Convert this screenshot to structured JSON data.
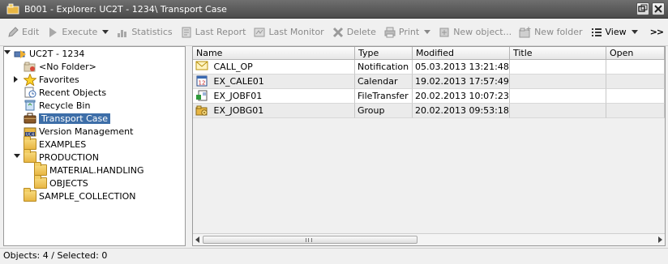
{
  "window": {
    "title": "B001 - Explorer: UC2T - 1234\\ Transport Case",
    "icon": "explorer-window-icon"
  },
  "toolbar": {
    "edit": "Edit",
    "execute": "Execute",
    "statistics": "Statistics",
    "last_report": "Last Report",
    "last_monitor": "Last Monitor",
    "delete": "Delete",
    "print": "Print",
    "new_object": "New object...",
    "new_folder": "New folder",
    "view": "View",
    "more": ">>"
  },
  "tree": {
    "root": "UC2T - 1234",
    "items": [
      {
        "label": "<No Folder>",
        "icon": "no-folder-icon"
      },
      {
        "label": "Favorites",
        "icon": "star-icon"
      },
      {
        "label": "Recent Objects",
        "icon": "recent-objects-icon"
      },
      {
        "label": "Recycle Bin",
        "icon": "recycle-bin-icon"
      },
      {
        "label": "Transport Case",
        "icon": "transport-case-icon",
        "selected": true
      },
      {
        "label": "Version Management",
        "icon": "version-management-icon"
      },
      {
        "label": "EXAMPLES",
        "icon": "folder-icon"
      },
      {
        "label": "PRODUCTION",
        "icon": "folder-icon"
      },
      {
        "label": "MATERIAL.HANDLING",
        "icon": "folder-icon"
      },
      {
        "label": "OBJECTS",
        "icon": "folder-icon"
      },
      {
        "label": "SAMPLE_COLLECTION",
        "icon": "folder-icon"
      }
    ]
  },
  "table": {
    "columns": [
      "Name",
      "Type",
      "Modified",
      "Title",
      "Open"
    ],
    "rows": [
      {
        "name": "CALL_OP",
        "type": "Notification",
        "modified": "05.03.2013 13:21:48",
        "title": "",
        "open": "",
        "icon": "notification-icon"
      },
      {
        "name": "EX_CALE01",
        "type": "Calendar",
        "modified": "19.02.2013 17:57:49",
        "title": "",
        "open": "",
        "icon": "calendar-icon"
      },
      {
        "name": "EX_JOBF01",
        "type": "FileTransfer",
        "modified": "20.02.2013 10:07:23",
        "title": "",
        "open": "",
        "icon": "file-transfer-icon"
      },
      {
        "name": "EX_JOBG01",
        "type": "Group",
        "modified": "20.02.2013 09:53:18",
        "title": "",
        "open": "",
        "icon": "group-icon"
      }
    ]
  },
  "status": {
    "objects": "Objects: 4",
    "selected": "/ Selected: 0"
  },
  "colors": {
    "titlebar": "#5a5a5a",
    "selection": "#3d6ea8",
    "folder": "#e8b643"
  }
}
